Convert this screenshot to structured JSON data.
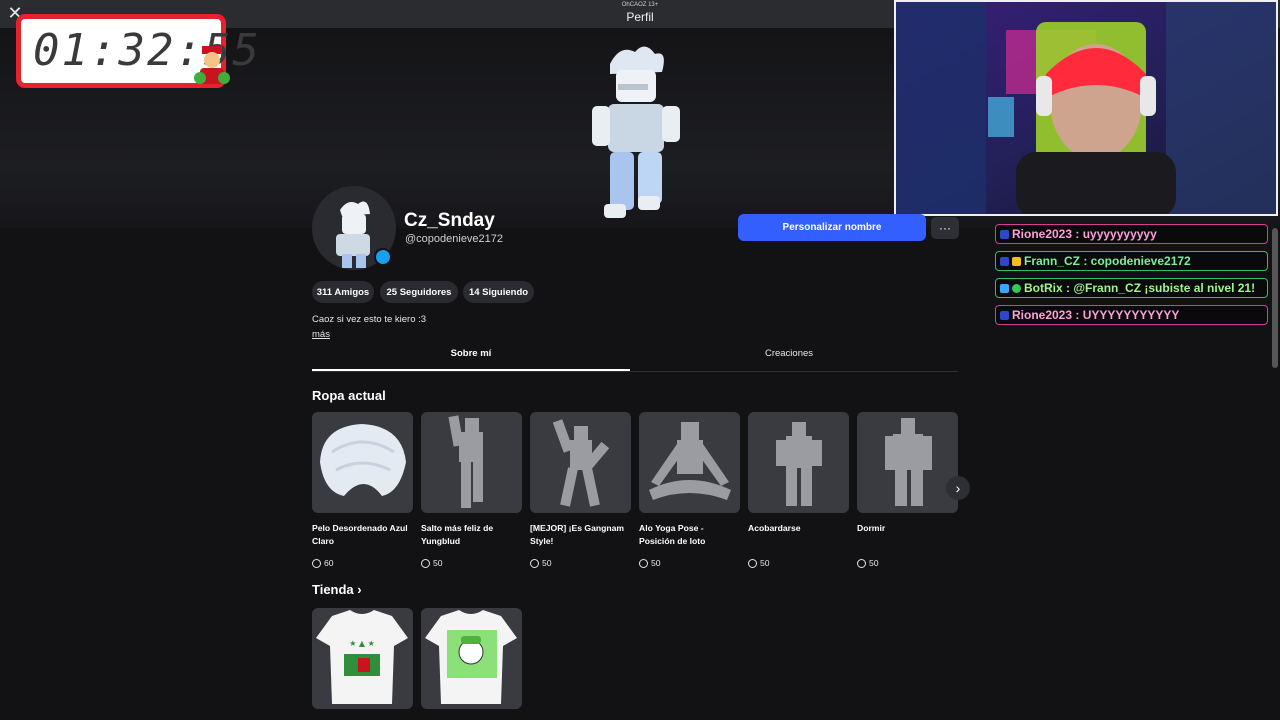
{
  "window": {
    "top_small": "OhCAOZ 13+",
    "title": "Perfil"
  },
  "timer": {
    "display": "01:32:55"
  },
  "profile": {
    "display_name": "Cz_Snday",
    "handle": "@copodenieve2172",
    "customize_button": "Personalizar nombre",
    "more_button": "···",
    "stats": [
      "311 Amigos",
      "25 Seguidores",
      "14 Siguiendo"
    ],
    "bio": "Caoz si vez esto te kiero :3",
    "more_link": "más"
  },
  "tabs": [
    {
      "label": "Sobre mí",
      "active": true
    },
    {
      "label": "Creaciones",
      "active": false
    }
  ],
  "current_outfit": {
    "title": "Ropa actual",
    "items": [
      {
        "name": "Pelo Desordenado Azul Claro",
        "price": "60"
      },
      {
        "name": "Salto más feliz de Yungblud",
        "price": "50"
      },
      {
        "name": "[MEJOR] ¡Es Gangnam Style!",
        "price": "50"
      },
      {
        "name": "Alo Yoga Pose - Posición de loto",
        "price": "50"
      },
      {
        "name": "Acobardarse",
        "price": "50"
      },
      {
        "name": "Dormir",
        "price": "50"
      }
    ]
  },
  "shop": {
    "title": "Tienda"
  },
  "chat": [
    {
      "text": "Rione2023 : uyyyyyyyyyy",
      "color": "#ff9fd8",
      "border": "#d43c96"
    },
    {
      "text": "Frann_CZ : copodenieve2172",
      "color": "#79f0a0",
      "border": "#2fbf68"
    },
    {
      "text": "BotRix : @Frann_CZ ¡subiste al nivel 21!",
      "color": "#9ff58a",
      "border": "#2fbf68"
    },
    {
      "text": "Rione2023 : UYYYYYYYYYYY",
      "color": "#ff9fd8",
      "border": "#d43c96"
    }
  ],
  "colors": {
    "accent": "#335fff",
    "background": "#121215",
    "card": "#3a3b40"
  }
}
